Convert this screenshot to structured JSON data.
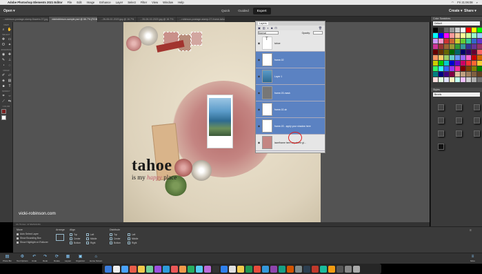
{
  "menubar": {
    "app": "Adobe Photoshop Elements 2021 Editor",
    "items": [
      "File",
      "Edit",
      "Image",
      "Enhance",
      "Layer",
      "Select",
      "Filter",
      "View",
      "Window",
      "Help"
    ],
    "time": "Fri 21:06:08"
  },
  "topbar": {
    "open_label": "Open",
    "modes": [
      "Quick",
      "Guided",
      "Expert"
    ],
    "create_label": "Create",
    "share_label": "Share"
  },
  "tabs": [
    "...robinson-postage-stamp-flowers-07.jpg @ 66.7% (RGB/8)",
    "vickirobinson-sample.psd @ 66.7% (RGB/8)",
    "...26-06-02-2020.jpg @ 16.7%",
    "...26-06-02-2020.jpg @ 16.7%",
    "...robinson-postage-stamp-07-frame-tahoe.psd @ 66.7%"
  ],
  "toolbox": {
    "sections": [
      "VIEW",
      "SELECT",
      "ENHANCE",
      "DRAW",
      "MODIFY",
      "COLOR"
    ],
    "fg_color": "#7a2020",
    "bg_color": "#ffffff"
  },
  "canvas": {
    "title": "tahoe",
    "sub_before": "is my ",
    "sub_happy": "happy",
    "sub_after": " place"
  },
  "watermark": "vicki-robinson.com",
  "status": "16.7%      Doc: 37.9M/339.6M",
  "layers_panel": {
    "tab": "Layers",
    "blend_mode": "Normal",
    "opacity_label": "Opacity:",
    "layers": [
      {
        "name": "tahoe",
        "selected": false
      },
      {
        "name": "frame-02",
        "selected": true
      },
      {
        "name": "Layer 1",
        "selected": true
      },
      {
        "name": "frame-03-mask",
        "selected": true
      },
      {
        "name": "frame-02-sh",
        "selected": true
      },
      {
        "name": "frame-03 - apply your shadow here",
        "selected": true
      },
      {
        "name": "lace/frame here anywhere gl...",
        "selected": false
      }
    ]
  },
  "color_swatches": {
    "title": "Color Swatches",
    "preset": "Default",
    "colors": [
      "#000000",
      "#333333",
      "#666666",
      "#999999",
      "#cccccc",
      "#ffffff",
      "#ff0000",
      "#ffff00",
      "#00ff00",
      "#00ffff",
      "#0000ff",
      "#ff00ff",
      "#ff9999",
      "#ffcc99",
      "#ffff99",
      "#ccff99",
      "#99ffcc",
      "#99ccff",
      "#cc99ff",
      "#ff99cc",
      "#cc3333",
      "#cc6633",
      "#cccc33",
      "#66cc33",
      "#33cc99",
      "#3366cc",
      "#6633cc",
      "#cc3399",
      "#993333",
      "#996633",
      "#999933",
      "#339933",
      "#339999",
      "#333399",
      "#663399",
      "#993366",
      "#660000",
      "#663300",
      "#666600",
      "#006600",
      "#006666",
      "#000066",
      "#330066",
      "#660033",
      "#ff6666",
      "#ff9966",
      "#ffcc66",
      "#99cc66",
      "#66cccc",
      "#6699ff",
      "#9966ff",
      "#ff66cc",
      "#cc0000",
      "#cc6600",
      "#cccc00",
      "#00cc00",
      "#00cccc",
      "#0000cc",
      "#6600cc",
      "#cc0066",
      "#ff3333",
      "#ff6633",
      "#ffcc33",
      "#33ff66",
      "#33ffff",
      "#3366ff",
      "#9933ff",
      "#ff3399",
      "#800000",
      "#804000",
      "#808000",
      "#008000",
      "#008080",
      "#000080",
      "#400080",
      "#800040",
      "#e0c0a0",
      "#c0a080",
      "#a08060",
      "#806040",
      "#604020",
      "#ffe0e0",
      "#e0ffe0",
      "#e0e0ff",
      "#fff0c0",
      "#c0fff0",
      "#f0c0ff",
      "#d0d0d0",
      "#b0b0b0",
      "#707070"
    ]
  },
  "styles_panel": {
    "title": "Styles",
    "preset": "Bevels"
  },
  "options": {
    "move_label": "Move",
    "checks": [
      "Auto Select Layer",
      "Show Bounding Box",
      "Show Highlight on Rollover"
    ],
    "arrange_label": "Arrange",
    "align_label": "Align",
    "align_items": [
      "Top",
      "Left",
      "Center",
      "Middle",
      "Bottom",
      "Right"
    ],
    "distribute_label": "Distribute",
    "distribute_items": [
      "Top",
      "Left",
      "Center",
      "Middle",
      "Bottom",
      "Right"
    ]
  },
  "bottombar": {
    "left": [
      "Photo Bin",
      "Tool Options",
      "Undo",
      "Redo",
      "Rotate",
      "Layout",
      "Organizer",
      "Home Screen"
    ],
    "right": [
      "More"
    ]
  }
}
